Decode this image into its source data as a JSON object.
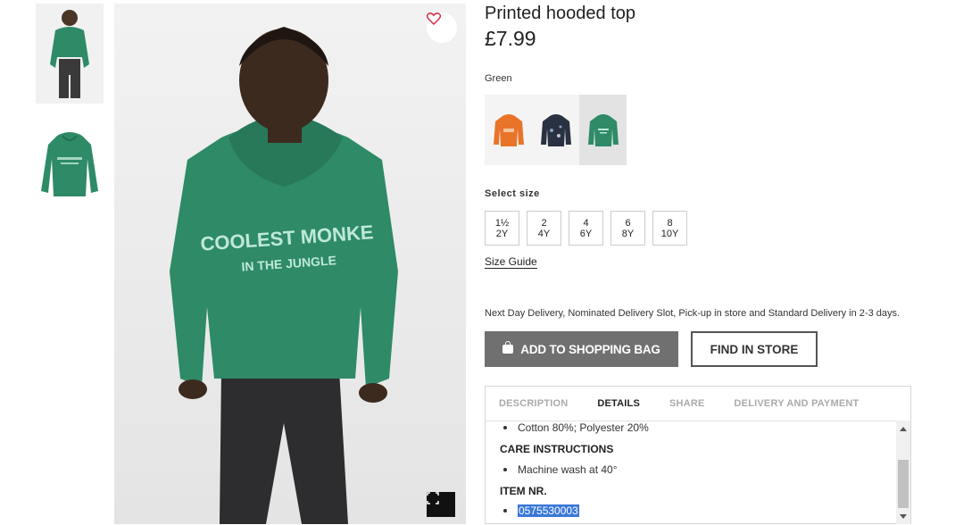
{
  "product": {
    "title": "Printed hooded top",
    "price": "£7.99",
    "color": "Green",
    "hoodie_print_line1": "COOLEST MONKE",
    "hoodie_print_line2": "IN THE JUNGLE"
  },
  "swatches": [
    {
      "color": "#e8742a",
      "label": "orange hooded top"
    },
    {
      "color": "#2a3142",
      "label": "navy hooded top"
    },
    {
      "color": "#2e8a67",
      "label": "green hooded top",
      "selected": true
    }
  ],
  "sizes": {
    "label": "Select size",
    "options": [
      {
        "line1": "1½",
        "line2": "2Y"
      },
      {
        "line1": "2",
        "line2": "4Y"
      },
      {
        "line1": "4",
        "line2": "6Y"
      },
      {
        "line1": "6",
        "line2": "8Y"
      },
      {
        "line1": "8",
        "line2": "10Y"
      }
    ],
    "guide": "Size Guide"
  },
  "delivery_text": "Next Day Delivery, Nominated Delivery Slot, Pick-up in store and Standard Delivery in 2-3 days.",
  "buttons": {
    "add_to_bag": "ADD TO SHOPPING BAG",
    "find_in_store": "FIND IN STORE"
  },
  "tabs": [
    {
      "label": "DESCRIPTION",
      "active": false
    },
    {
      "label": "DETAILS",
      "active": true
    },
    {
      "label": "SHARE",
      "active": false
    },
    {
      "label": "DELIVERY AND PAYMENT",
      "active": false
    }
  ],
  "details": {
    "composition": "Cotton 80%; Polyester 20%",
    "care_heading": "CARE INSTRUCTIONS",
    "care_item": "Machine wash at 40°",
    "item_nr_heading": "ITEM NR.",
    "item_nr": "0575530003"
  },
  "colors": {
    "hoodie_green": "#2e8a67",
    "add_bag_bg": "#707070",
    "selection_blue": "#3b78d8"
  }
}
